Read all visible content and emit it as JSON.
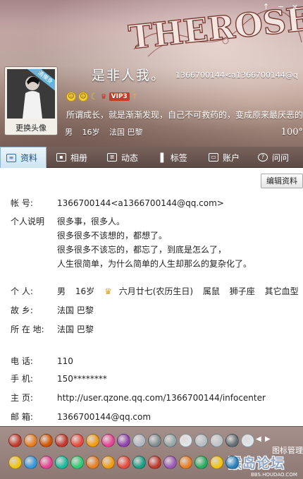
{
  "header": {
    "banner_text": "THEROSE",
    "window_controls": [
      "↑",
      "−",
      "×"
    ],
    "avatar_ribbon": "清樂身",
    "change_avatar_label": "更换头像",
    "nickname": "是非人我。",
    "account": "1366700144<a1366700144@q",
    "vip_label": "VIP3",
    "signature": "所谓成长，就是渐渐发现，自己不可救药的，变成原来最厌恶的",
    "basic": {
      "gender": "男",
      "age": "16岁",
      "location": "法国 巴黎"
    },
    "completion": "100°"
  },
  "tabs": [
    {
      "label": "资料",
      "icon": "profile-card-icon",
      "active": true
    },
    {
      "label": "相册",
      "icon": "photo-icon",
      "active": false
    },
    {
      "label": "动态",
      "icon": "feed-icon",
      "active": false
    },
    {
      "label": "标签",
      "icon": "bookmark-icon",
      "active": false
    },
    {
      "label": "账户",
      "icon": "wallet-icon",
      "active": false
    },
    {
      "label": "问问",
      "icon": "question-icon",
      "active": false
    }
  ],
  "profile": {
    "edit_button": "编辑资料",
    "account_label": "帐    号:",
    "account_value": "1366700144<a1366700144@qq.com>",
    "bio_label": "个人说明",
    "bio_lines": [
      "很多事，很多人。",
      "很多很多不该想的，都想了。",
      "很多很多不该忘的，都忘了，到底是怎么了，",
      "人生很简单，为什么简单的人生却那么的复杂化了。"
    ],
    "personal_label": "个    人:",
    "personal": {
      "gender": "男",
      "age": "16岁",
      "birthday": "六月廿七(农历生日)",
      "zodiac": "属鼠",
      "star_sign": "狮子座",
      "blood": "其它血型"
    },
    "hometown_label": "故    乡:",
    "hometown": "法国 巴黎",
    "location_label": "所 在 地:",
    "location": "法国 巴黎",
    "phone_label": "电    话:",
    "phone": "110",
    "mobile_label": "手    机:",
    "mobile": "150********",
    "homepage_label": "主    页:",
    "homepage": "http://user.qzone.qq.com/1366700144/infocenter",
    "email_label": "邮    箱:",
    "email": "1366700144@qq.com"
  },
  "emoticons": {
    "manage_label": "图标管理",
    "row1_colors": [
      "#c0392b",
      "#e67e22",
      "#d35400",
      "#c0392b",
      "#e74c3c",
      "#f39c12",
      "#e84393",
      "#8e44ad",
      "#b0b7c0",
      "#7f8c8d",
      "#95a5a6",
      "#dfe6e9",
      "#b2bec3",
      "#bdc3c7",
      "#636e72",
      "#dfe6e9"
    ],
    "row2_colors": [
      "#f1c40f",
      "#3498db",
      "#e84393",
      "#1abc9c",
      "#2ecc71",
      "#e67e22",
      "#f39c12",
      "#e74c3c",
      "#16a085",
      "#c0392b",
      "#9b59b6",
      "#e67e22",
      "#27ae60",
      "#f1c40f",
      "#2980b9"
    ],
    "watermark": "猴岛论坛",
    "watermark_url": "BBS.HOUDAO.COM"
  }
}
